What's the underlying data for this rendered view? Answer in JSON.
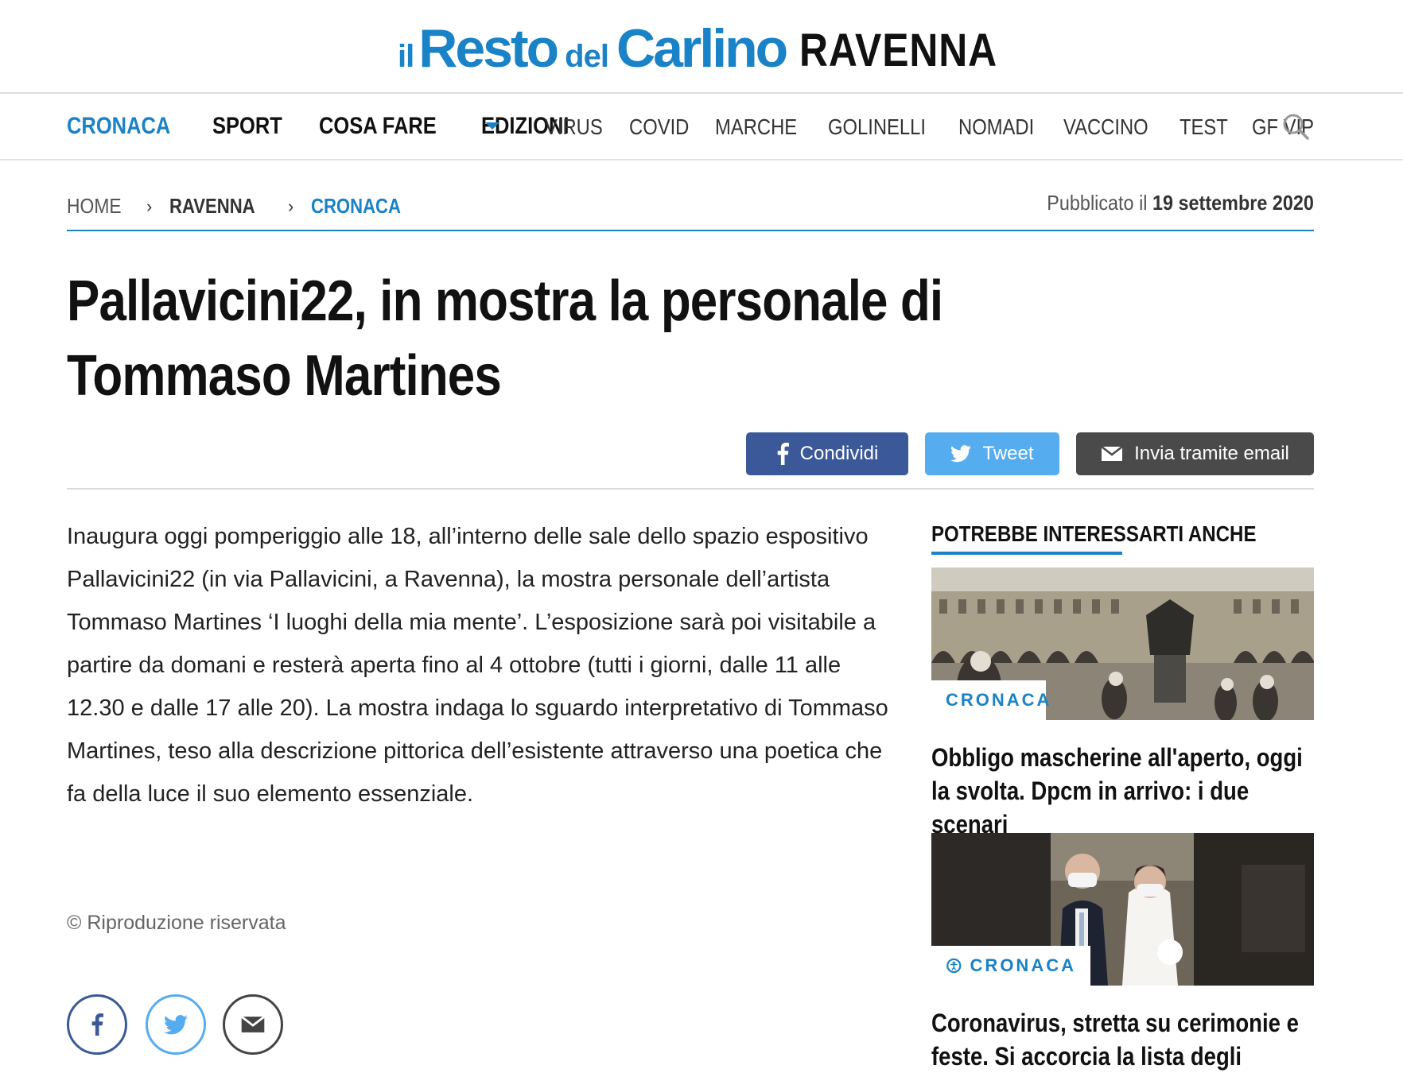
{
  "header": {
    "logo_il": "il",
    "logo_resto": "Resto",
    "logo_del": "del",
    "logo_carlino": "Carlino",
    "edition": "RAVENNA"
  },
  "nav": {
    "main": [
      "CRONACA",
      "SPORT",
      "COSA FARE",
      "EDIZIONI"
    ],
    "trending": [
      "VIRUS",
      "COVID",
      "MARCHE",
      "GOLINELLI",
      "NOMADI",
      "VACCINO",
      "TEST",
      "GF VIP"
    ],
    "search_icon": "search-icon"
  },
  "breadcrumb": {
    "home": "HOME",
    "separator": "›",
    "level1": "RAVENNA",
    "level2": "CRONACA"
  },
  "published": {
    "prefix": "Pubblicato il",
    "date": "19 settembre 2020"
  },
  "article": {
    "title": "Pallavicini22, in mostra la personale di Tommaso Martines",
    "body": "Inaugura oggi pomperiggio alle 18, all’interno delle sale dello spazio espositivo Pallavicini22 (in via Pallavicini, a Ravenna), la mostra personale dell’artista Tommaso Martines ‘I luoghi della mia mente’. L’esposizione sarà poi visitabile a partire da domani e resterà aperta fino al 4 ottobre (tutti i giorni, dalle 11 alle 12.30 e dalle 17 alle 20). La mostra indaga lo sguardo interpretativo di Tommaso Martines, teso alla descrizione pittorica dell’esistente attraverso una poetica che fa della luce il suo elemento essenziale.",
    "copyright": "© Riproduzione riservata"
  },
  "share": {
    "facebook": "Condividi",
    "twitter": "Tweet",
    "email": "Invia tramite email"
  },
  "sidebar": {
    "title": "POTREBBE INTERESSARTI ANCHE",
    "cards": [
      {
        "badge": "CRONACA",
        "title": "Obbligo mascherine all'aperto, oggi la svolta. Dpcm in arrivo: i due scenari"
      },
      {
        "badge": "CRONACA",
        "title": "Coronavirus, stretta su cerimonie e feste. Si accorcia la lista degli"
      }
    ]
  },
  "colors": {
    "brand": "#1a82c6",
    "facebook": "#3b5998",
    "twitter": "#55acee",
    "email": "#4a4a4a"
  }
}
